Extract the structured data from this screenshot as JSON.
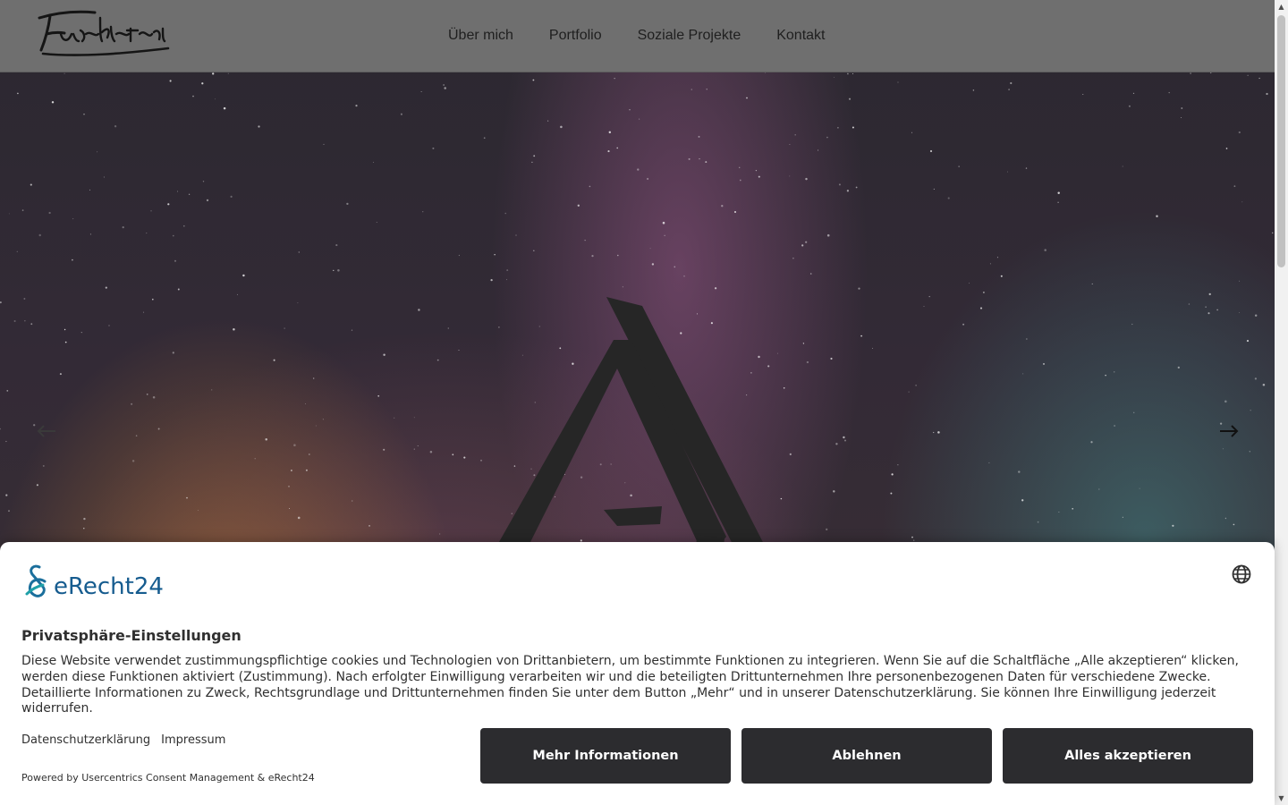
{
  "header": {
    "logo_text": "Furiosklatsch",
    "menu": [
      {
        "label": "Über mich"
      },
      {
        "label": "Portfolio"
      },
      {
        "label": "Soziale Projekte"
      },
      {
        "label": "Kontakt"
      }
    ]
  },
  "slider": {
    "prev_icon": "arrow-left-icon",
    "next_icon": "arrow-right-icon"
  },
  "consent": {
    "brand": "eRecht24",
    "language_icon": "globe-icon",
    "title": "Privatsphäre-Einstellungen",
    "text": "Diese Website verwendet zustimmungspflichtige cookies und Technologien von Drittanbietern, um bestimmte Funktionen zu integrieren. Wenn Sie auf die Schaltfläche „Alle akzeptieren“ klicken, werden diese Funktionen aktiviert (Zustimmung). Nach erfolgter Einwilligung verarbeiten wir und die beteiligten Drittunternehmen Ihre personenbezogenen Daten für verschiedene Zwecke. Detaillierte Informationen zu Zweck, Rechtsgrundlage und Drittunternehmen finden Sie unter dem Button „Mehr“ und in unserer Datenschutzerklärung. Sie können Ihre Einwilligung jederzeit widerrufen.",
    "links": {
      "privacy": "Datenschutzerklärung",
      "imprint": "Impressum"
    },
    "powered": "Powered by Usercentrics Consent Management & eRecht24",
    "buttons": {
      "more": "Mehr Informationen",
      "deny": "Ablehnen",
      "accept": "Alles akzeptieren"
    }
  },
  "colors": {
    "header_bg": "#6f6f6f",
    "button_bg": "#2c2c2f",
    "brand_blue": "#165c8f"
  }
}
